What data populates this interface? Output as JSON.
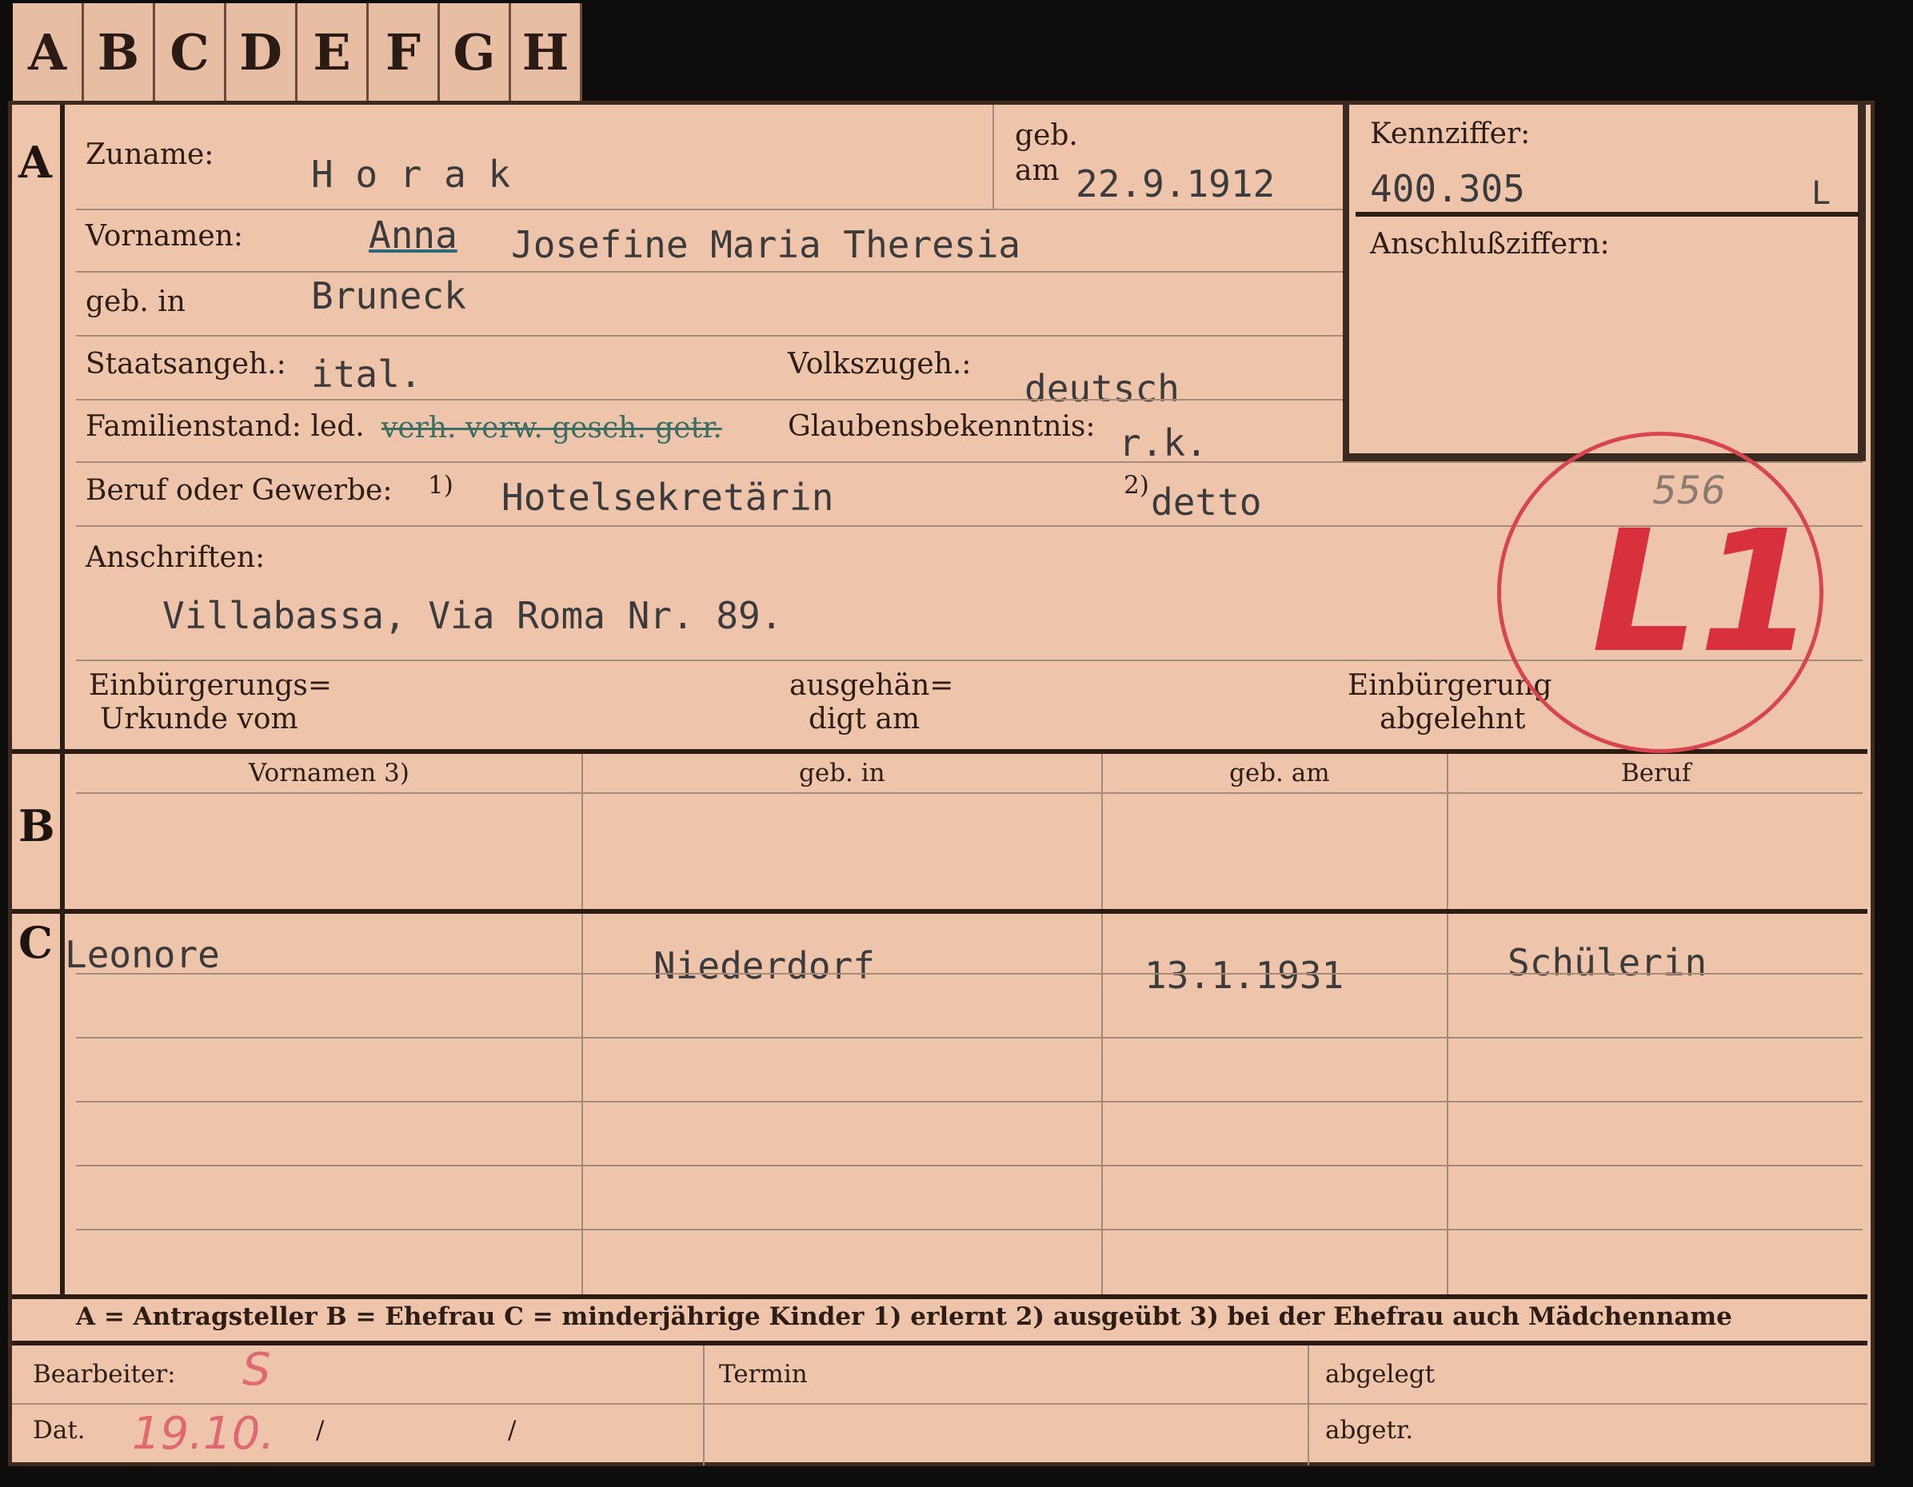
{
  "tabs": [
    "A",
    "B",
    "C",
    "D",
    "E",
    "F",
    "G",
    "H"
  ],
  "sections": {
    "a": "A",
    "b": "B",
    "c": "C"
  },
  "labels": {
    "zuname": "Zuname:",
    "geb": "geb.",
    "am": "am",
    "kennziffer": "Kennziffer:",
    "anschlussziffern": "Anschlußziffern:",
    "vornamen": "Vornamen:",
    "geb_in": "geb. in",
    "staatsangeh": "Staatsangeh.:",
    "volkszugeh": "Volkszugeh.:",
    "familienstand": "Familienstand: led.",
    "familienstand_struck": "verh. verw. gesch. getr.",
    "glaubensbekenntnis": "Glaubensbekenntnis:",
    "beruf_oder_gewerbe": "Beruf oder Gewerbe:",
    "fn1": "1)",
    "fn2": "2)",
    "anschriften": "Anschriften:",
    "einbuergerungs": "Einbürgerungs=",
    "urkunde_vom": "Urkunde vom",
    "ausgehaen": "ausgehän=",
    "digt_am": "digt am",
    "einbuergerung": "Einbürgerung",
    "abgelehnt": "abgelehnt",
    "col_vornamen": "Vornamen 3)",
    "col_geb_in": "geb. in",
    "col_geb_am": "geb. am",
    "col_beruf": "Beruf",
    "legend": "A = Antragsteller   B = Ehefrau   C = minderjährige Kinder   1) erlernt   2) ausgeübt   3) bei der Ehefrau auch Mädchenname",
    "bearbeiter": "Bearbeiter:",
    "termin": "Termin",
    "abgelegt": "abgelegt",
    "dat": "Dat.",
    "slash1": "/",
    "slash2": "/",
    "abgetr": "abgetr."
  },
  "values": {
    "zuname": "H o r a k",
    "geb_am": "22.9.1912",
    "kennziffer": "400.305",
    "kennziffer_suffix": "L",
    "rufname": "Anna",
    "vornamen_rest": "Josefine Maria Theresia",
    "geb_in": "Bruneck",
    "staatsangeh": "ital.",
    "volkszugeh": "deutsch",
    "glaubensbekenntnis": "r.k.",
    "beruf_erlernt": "Hotelsekretärin",
    "beruf_ausgeuebt": "detto",
    "anschrift": "Villabassa, Via Roma Nr. 89."
  },
  "children": [
    {
      "vorname": "Leonore",
      "geb_in": "Niederdorf",
      "geb_am": "13.1.1931",
      "beruf": "Schülerin"
    }
  ],
  "stamp": {
    "number": "556",
    "text": "L1",
    "color": "#d8303c"
  },
  "handwritten": {
    "bearbeiter": "S",
    "datum": "19.10."
  }
}
